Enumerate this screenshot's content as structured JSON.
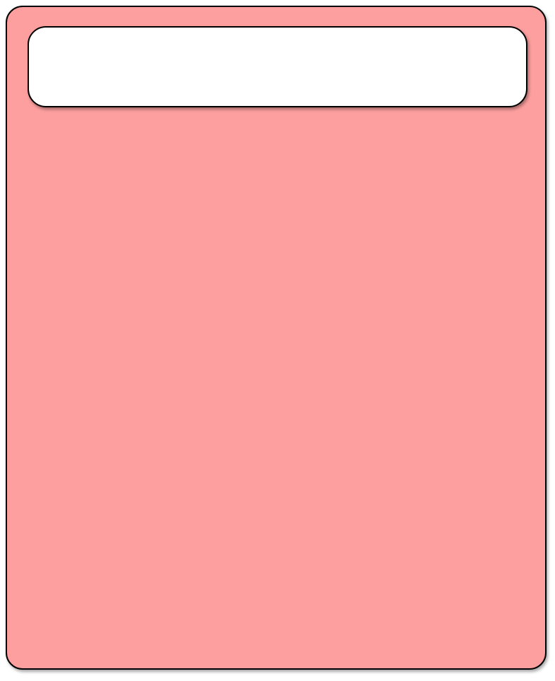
{
  "colors": {
    "outer_panel_fill": "#fd9f9f",
    "header_box_fill": "#ffffff",
    "border": "#000000"
  },
  "header_box": {
    "text": ""
  }
}
